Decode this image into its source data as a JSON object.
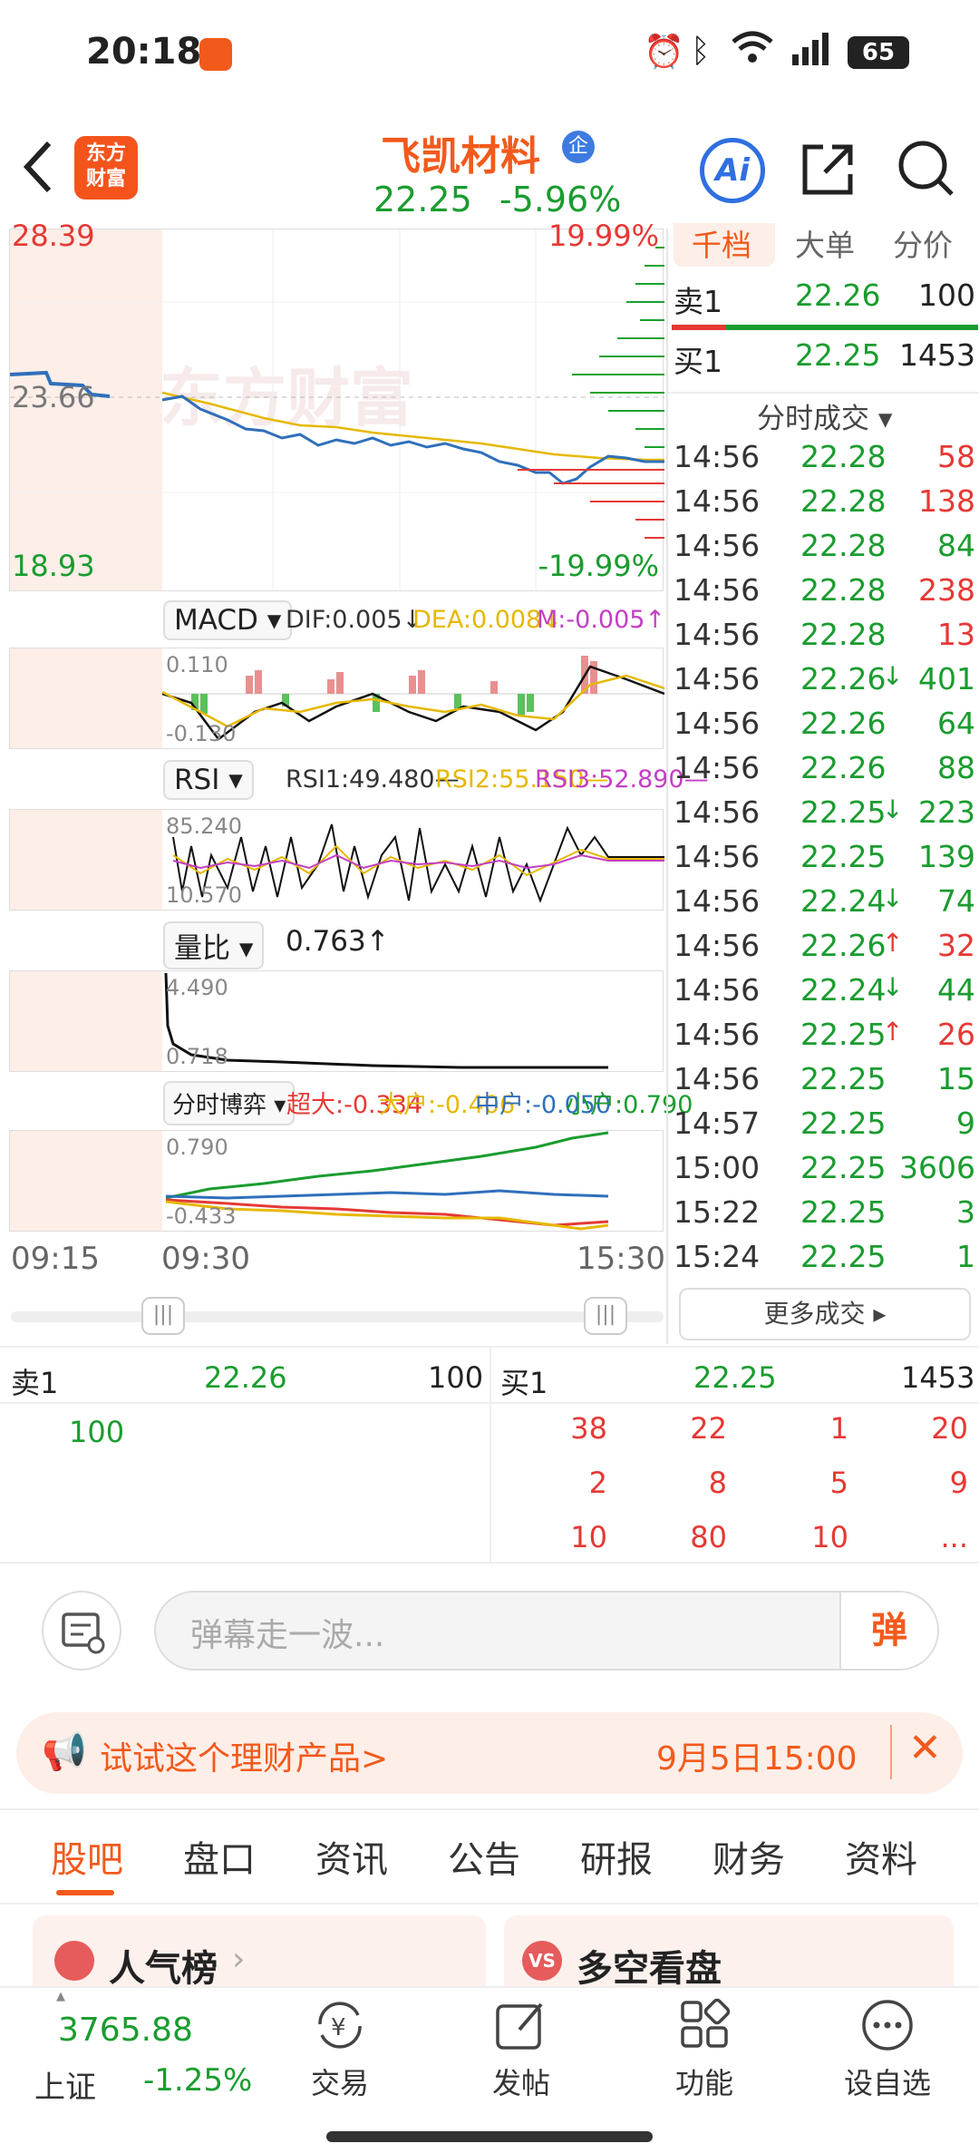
{
  "status": {
    "time": "20:18",
    "battery": "65"
  },
  "header": {
    "stock_name": "飞凯材料",
    "badge": "企",
    "price": "22.25",
    "change": "-5.96%",
    "logo_top": "东方",
    "logo_bottom": "财富"
  },
  "chart": {
    "price_high": "28.39",
    "price_mid": "23.66",
    "price_low": "18.93",
    "pct_high": "19.99%",
    "pct_low": "-19.99%",
    "watermark": "东方财富",
    "macd": {
      "selector": "MACD",
      "dif": "DIF:0.005↓",
      "dea": "DEA:0.008↓",
      "m": "M:-0.005↑",
      "top": "0.110",
      "bottom": "-0.130"
    },
    "rsi": {
      "selector": "RSI",
      "r1": "RSI1:49.480—",
      "r2": "RSI2:55.150—",
      "r3": "RSI3:52.890—",
      "top": "85.240",
      "bottom": "10.570"
    },
    "vol_ratio": {
      "selector": "量比",
      "value": "0.763↑",
      "top": "4.490",
      "bottom": "0.718"
    },
    "game": {
      "selector": "分时博弈",
      "super": "超大:-0.334",
      "large": "大户:-0.406",
      "mid": "中户:-0.050",
      "small": "小户:0.790",
      "top": "0.790",
      "bottom": "-0.433"
    },
    "time_start": "09:15",
    "time_open": "09:30",
    "time_end": "15:30"
  },
  "right": {
    "tabs": [
      "千档",
      "大单",
      "分价"
    ],
    "sell1": {
      "label": "卖1",
      "price": "22.26",
      "qty": "100"
    },
    "buy1": {
      "label": "买1",
      "price": "22.25",
      "qty": "1453"
    },
    "trades_title": "分时成交 ▾",
    "trades": [
      {
        "t": "14:56",
        "p": "22.28",
        "q": "58",
        "qc": "red",
        "a": ""
      },
      {
        "t": "14:56",
        "p": "22.28",
        "q": "138",
        "qc": "red",
        "a": ""
      },
      {
        "t": "14:56",
        "p": "22.28",
        "q": "84",
        "qc": "green",
        "a": ""
      },
      {
        "t": "14:56",
        "p": "22.28",
        "q": "238",
        "qc": "red",
        "a": ""
      },
      {
        "t": "14:56",
        "p": "22.28",
        "q": "13",
        "qc": "red",
        "a": ""
      },
      {
        "t": "14:56",
        "p": "22.26",
        "q": "401",
        "qc": "green",
        "a": "↓"
      },
      {
        "t": "14:56",
        "p": "22.26",
        "q": "64",
        "qc": "green",
        "a": ""
      },
      {
        "t": "14:56",
        "p": "22.26",
        "q": "88",
        "qc": "green",
        "a": ""
      },
      {
        "t": "14:56",
        "p": "22.25",
        "q": "223",
        "qc": "green",
        "a": "↓"
      },
      {
        "t": "14:56",
        "p": "22.25",
        "q": "139",
        "qc": "green",
        "a": ""
      },
      {
        "t": "14:56",
        "p": "22.24",
        "q": "74",
        "qc": "green",
        "a": "↓"
      },
      {
        "t": "14:56",
        "p": "22.26",
        "q": "32",
        "qc": "red",
        "a": "↑"
      },
      {
        "t": "14:56",
        "p": "22.24",
        "q": "44",
        "qc": "green",
        "a": "↓"
      },
      {
        "t": "14:56",
        "p": "22.25",
        "q": "26",
        "qc": "red",
        "a": "↑"
      },
      {
        "t": "14:56",
        "p": "22.25",
        "q": "15",
        "qc": "green",
        "a": ""
      },
      {
        "t": "14:57",
        "p": "22.25",
        "q": "9",
        "qc": "green",
        "a": ""
      },
      {
        "t": "15:00",
        "p": "22.25",
        "q": "3606",
        "qc": "green",
        "a": ""
      },
      {
        "t": "15:22",
        "p": "22.25",
        "q": "3",
        "qc": "green",
        "a": ""
      },
      {
        "t": "15:24",
        "p": "22.25",
        "q": "1",
        "qc": "green",
        "a": ""
      }
    ],
    "more": "更多成交 ▸"
  },
  "orderbook": {
    "sell_label": "卖1",
    "sell_price": "22.26",
    "sell_qty": "100",
    "sell_detail": "100",
    "buy_label": "买1",
    "buy_price": "22.25",
    "buy_qty": "1453",
    "buy_detail": [
      [
        "38",
        "22",
        "1",
        "20"
      ],
      [
        "2",
        "8",
        "5",
        "9"
      ],
      [
        "10",
        "80",
        "10",
        "..."
      ]
    ]
  },
  "danmu": {
    "placeholder": "弹幕走一波...",
    "button": "弹"
  },
  "promo": {
    "text": "试试这个理财产品>",
    "time": "9月5日15:00"
  },
  "tabs": [
    "股吧",
    "盘口",
    "资讯",
    "公告",
    "研报",
    "财务",
    "资料"
  ],
  "cards": {
    "left": "人气榜",
    "right": "多空看盘"
  },
  "index": {
    "value": "3765.88",
    "name": "上证",
    "change": "-1.25%"
  },
  "nav": [
    "交易",
    "发帖",
    "功能",
    "设自选"
  ]
}
